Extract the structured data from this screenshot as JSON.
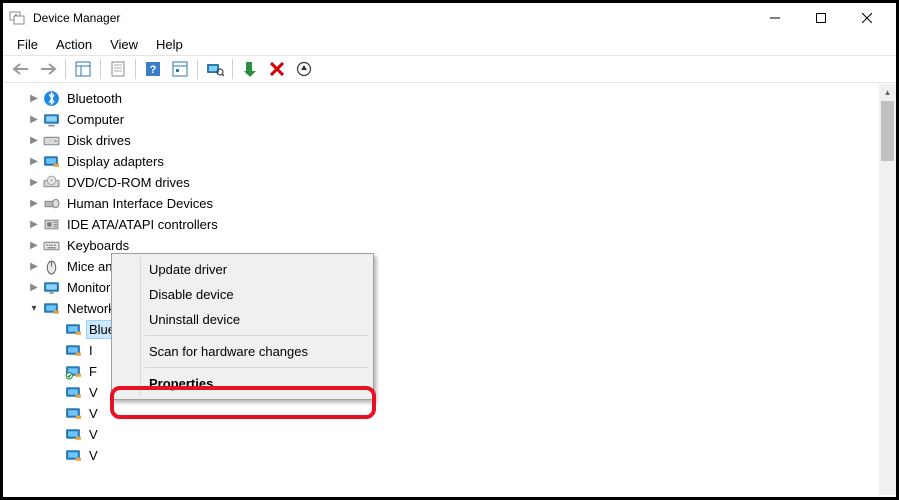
{
  "window": {
    "title": "Device Manager"
  },
  "menu": {
    "file": "File",
    "action": "Action",
    "view": "View",
    "help": "Help"
  },
  "tree": {
    "bluetooth": "Bluetooth",
    "computer": "Computer",
    "disk_drives": "Disk drives",
    "display_adapters": "Display adapters",
    "dvd": "DVD/CD-ROM drives",
    "hid": "Human Interface Devices",
    "ide": "IDE ATA/ATAPI controllers",
    "keyboards": "Keyboards",
    "mice": "Mice and other pointing devices",
    "monitors": "Monitors",
    "network_adapters": "Network adapters",
    "na_sel": "Bluetooth Device (Personal Area Network)",
    "na_1": "I",
    "na_2": "F",
    "na_3": "V",
    "na_4": "V",
    "na_5": "V",
    "na_6": "V"
  },
  "context_menu": {
    "update": "Update driver",
    "disable": "Disable device",
    "uninstall": "Uninstall device",
    "scan": "Scan for hardware changes",
    "properties": "Properties"
  }
}
